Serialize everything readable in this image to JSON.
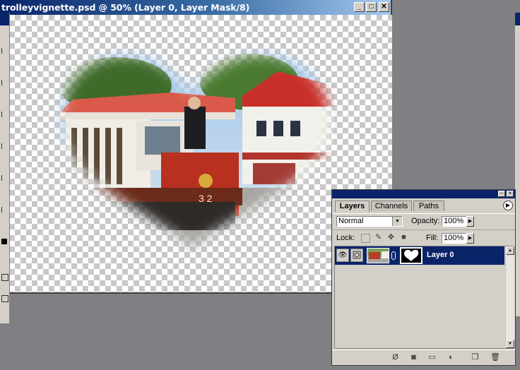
{
  "document": {
    "title": "trolleyvignette.psd @ 50% (Layer 0, Layer Mask/8)",
    "minimize_glyph": "_",
    "maximize_glyph": "□",
    "close_glyph": "✕"
  },
  "layers_panel": {
    "tabs": [
      {
        "label": "Layers",
        "active": true
      },
      {
        "label": "Channels",
        "active": false
      },
      {
        "label": "Paths",
        "active": false
      }
    ],
    "blend_mode": "Normal",
    "opacity_label": "Opacity:",
    "opacity_value": "100%",
    "lock_label": "Lock:",
    "fill_label": "Fill:",
    "fill_value": "100%",
    "layers": [
      {
        "name": "Layer 0",
        "selected": true,
        "visible": true
      }
    ]
  },
  "colors": {
    "titlebar_start": "#0a246a",
    "titlebar_end": "#a6caf0",
    "selection": "#0a246a",
    "panel_bg": "#d4d0c8",
    "workspace": "#7f7f84"
  },
  "icons": {
    "visibility": "eye-icon",
    "brush": "brush-icon",
    "link": "chain-link-icon",
    "panel_menu": "panel-menu-arrow-icon",
    "lock_transparency": "lock-transparent-pixels-icon",
    "lock_paint": "lock-image-pixels-icon",
    "lock_position": "lock-position-icon",
    "lock_all": "lock-all-icon",
    "add_style": "layer-style-icon",
    "add_mask": "layer-mask-icon",
    "new_set": "folder-icon",
    "adjustment": "adjustment-layer-icon",
    "new_layer": "new-layer-icon",
    "delete": "trash-icon"
  }
}
